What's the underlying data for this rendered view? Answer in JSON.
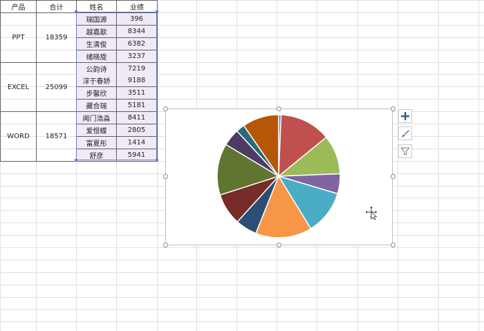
{
  "headers": {
    "product": "产品",
    "total": "合计",
    "name": "姓名",
    "score": "业绩"
  },
  "groups": [
    {
      "product": "PPT",
      "total": "18359"
    },
    {
      "product": "EXCEL",
      "total": "25099"
    },
    {
      "product": "WORD",
      "total": "18571"
    }
  ],
  "rows": [
    {
      "name": "瑞国源",
      "score": "396"
    },
    {
      "name": "越嘉歆",
      "score": "8344"
    },
    {
      "name": "生清俊",
      "score": "6382"
    },
    {
      "name": "绪晓旋",
      "score": "3237"
    },
    {
      "name": "公韵诗",
      "score": "7219"
    },
    {
      "name": "淳于春娇",
      "score": "9188"
    },
    {
      "name": "步馨欣",
      "score": "3511"
    },
    {
      "name": "藏合瑞",
      "score": "5181"
    },
    {
      "name": "闻门浩淼",
      "score": "8411"
    },
    {
      "name": "爱恨蝶",
      "score": "2805"
    },
    {
      "name": "富夏彤",
      "score": "1414"
    },
    {
      "name": "舒彦",
      "score": "5941"
    }
  ],
  "colors": {
    "selection": "#6b7ec9",
    "name_fill": "#efeaf6"
  },
  "chart_data": {
    "type": "pie",
    "categories": [
      "瑞国源",
      "越嘉歆",
      "生清俊",
      "绪晓旋",
      "公韵诗",
      "淳于春娇",
      "步馨欣",
      "藏合瑞",
      "闻门浩淼",
      "爱恨蝶",
      "富夏彤",
      "舒彦"
    ],
    "values": [
      396,
      8344,
      6382,
      3237,
      7219,
      9188,
      3511,
      5181,
      8411,
      2805,
      1414,
      5941
    ],
    "colors": [
      "#4f7fbf",
      "#c0504d",
      "#9bbb59",
      "#8064a2",
      "#4bacc6",
      "#f79646",
      "#2c4d75",
      "#772c2a",
      "#5f7530",
      "#4d3b62",
      "#276a7c",
      "#b65708"
    ],
    "title": "",
    "legend": "none"
  },
  "chart_tools": {
    "add_icon": "plus-icon",
    "style_icon": "brush-icon",
    "filter_icon": "filter-icon"
  }
}
